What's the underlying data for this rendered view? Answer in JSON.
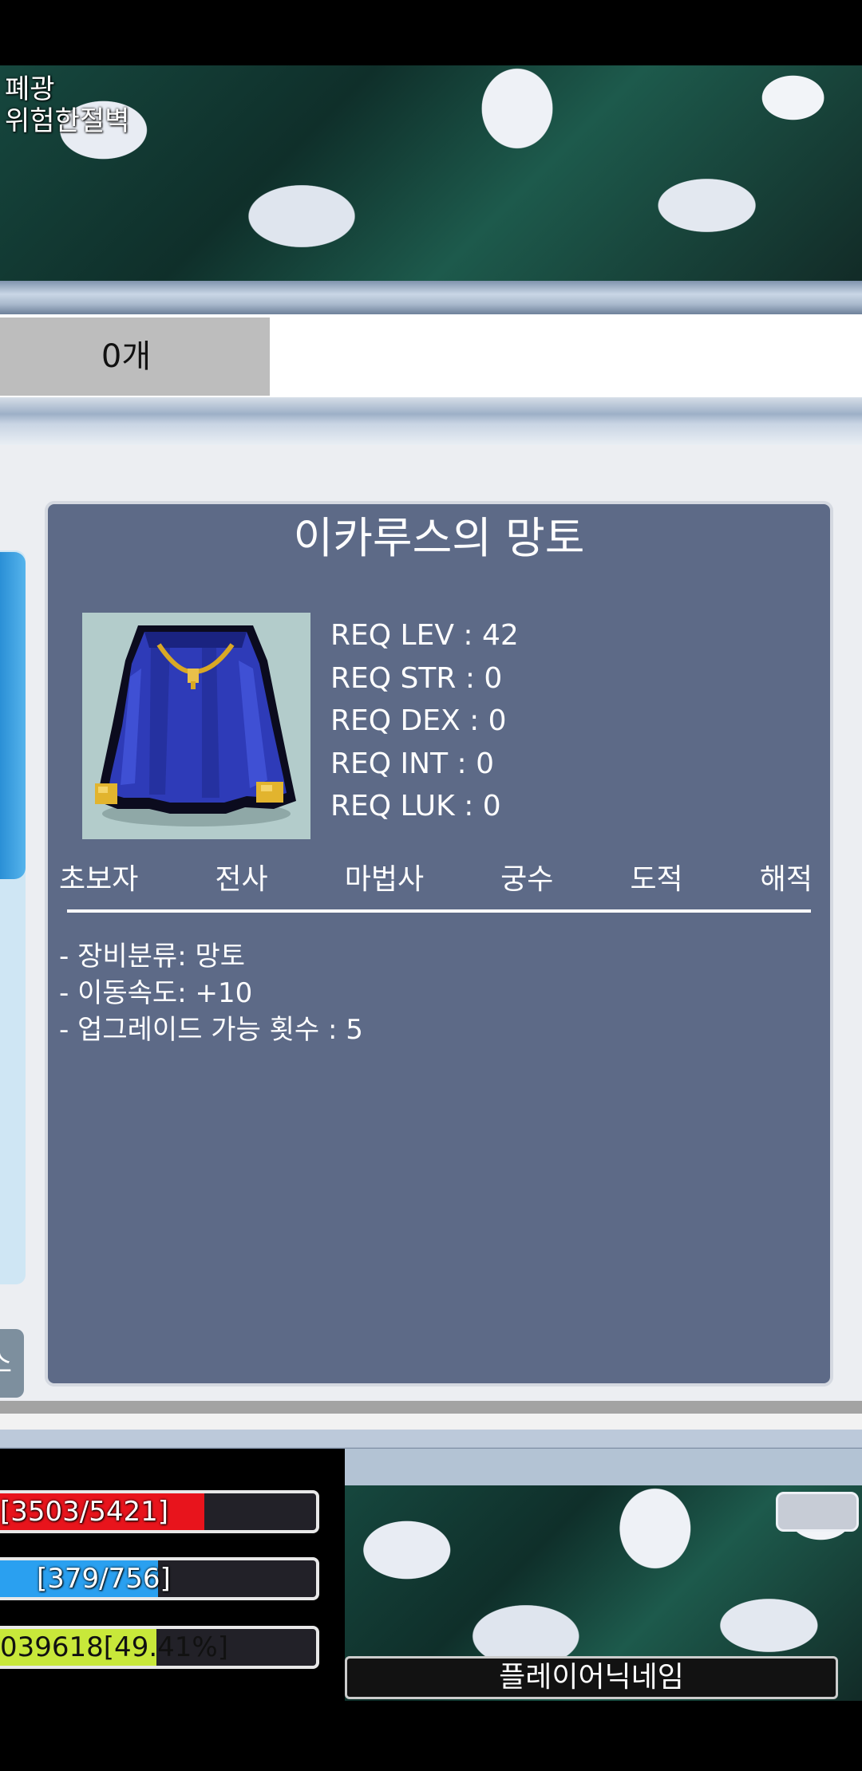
{
  "map": {
    "region": "폐광",
    "name": "위험한절벽"
  },
  "inventory": {
    "count_label": "0개"
  },
  "item": {
    "name": "이카루스의 망토",
    "icon": "blue-cape-icon",
    "requirements": [
      "REQ LEV : 42",
      "REQ STR : 0",
      "REQ DEX : 0",
      "REQ INT : 0",
      "REQ LUK : 0"
    ],
    "jobs": [
      "초보자",
      "전사",
      "마법사",
      "궁수",
      "도적",
      "해적"
    ],
    "details": [
      "- 장비분류: 망토",
      "- 이동속도: +10",
      "- 업그레이드 가능 횟수 : 5"
    ]
  },
  "side_button_glyph": "소",
  "status": {
    "hp": {
      "text": "[3503/5421]",
      "ratio": 0.646,
      "color": "#e8141c"
    },
    "mp": {
      "text": "[379/756]",
      "ratio": 0.501,
      "color": "#2aa0f0"
    },
    "exp": {
      "text": "039618[49.41%]",
      "ratio": 0.4941,
      "color": "#c8e83a"
    }
  },
  "player": {
    "nickname": "플레이어닉네임"
  }
}
